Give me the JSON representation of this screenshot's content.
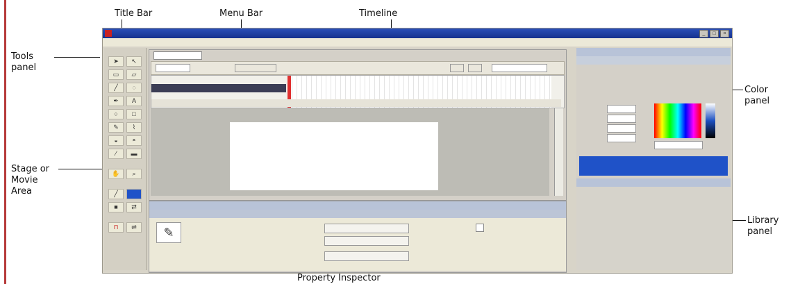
{
  "callouts": {
    "title_bar": "Title Bar",
    "menu_bar": "Menu Bar",
    "timeline": "Timeline",
    "tools_panel": "Tools\npanel",
    "color_panel": "Color\npanel",
    "stage": "Stage or\nMovie\nArea",
    "library_panel": "Library\npanel",
    "property_inspector": "Property Inspector"
  },
  "colors": {
    "frame_line": "#b63a3a",
    "title_bar": "#1f3fa0",
    "stage": "#ffffff",
    "color_panel_bar": "#1f52c8"
  }
}
